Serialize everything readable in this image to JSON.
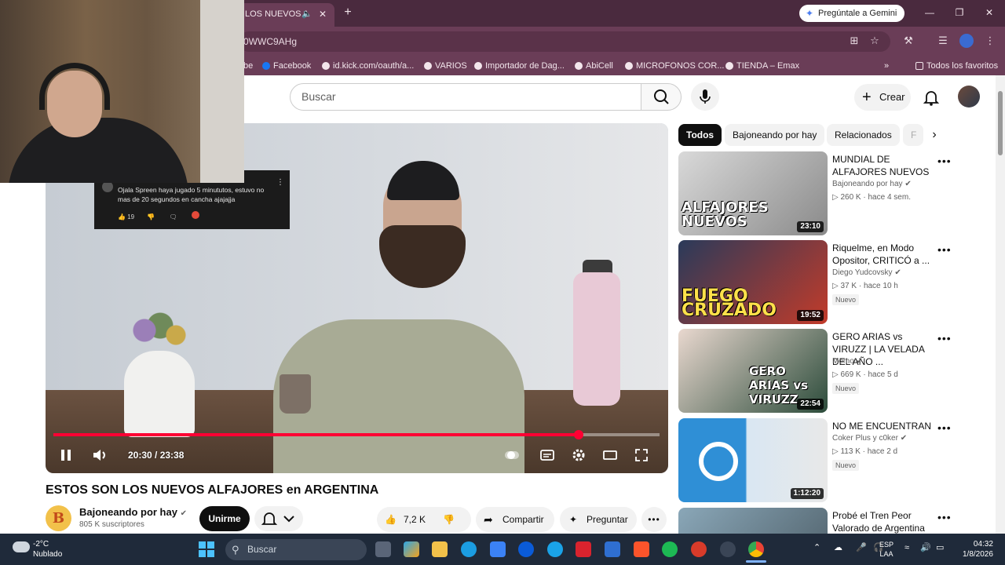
{
  "browser": {
    "tab_title": "LOS NUEVOS A",
    "tab_audio_icon": "speaker-icon",
    "new_tab": "+",
    "gemini_button": "Pregúntale a Gemini",
    "url": "0WWC9AHg",
    "bookmarks": [
      "be",
      "Facebook",
      "id.kick.com/oauth/a...",
      "VARIOS",
      "Importador de Dag...",
      "AbiCell",
      "MICROFONOS COR...",
      "TIENDA – Emax"
    ],
    "bookmarks_more": "»",
    "all_bookmarks": "Todos los favoritos"
  },
  "youtube": {
    "search_placeholder": "Buscar",
    "create_label": "Crear",
    "chips": [
      "Todos",
      "Bajoneando por hay",
      "Relacionados",
      "F"
    ],
    "player": {
      "time": "20:30 / 23:38",
      "progress": 0.867,
      "comment_text": "Ojala Spreen haya jugado 5 minututos, estuvo no mas de 20 segundos en cancha ajajajja",
      "comment_likes": "19"
    },
    "video": {
      "title": "ESTOS SON LOS NUEVOS ALFAJORES en ARGENTINA",
      "channel": "Bajoneando por hay",
      "subscribers": "805 K suscriptores",
      "channel_initial": "B",
      "join_label": "Unirme",
      "likes": "7,2 K",
      "share_label": "Compartir",
      "ask_label": "Preguntar"
    },
    "recommendations": [
      {
        "title": "MUNDIAL DE ALFAJORES NUEVOS",
        "channel": "Bajoneando por hay",
        "views": "260 K",
        "age": "hace 4 sem.",
        "duration": "23:10",
        "badge": "",
        "thumb_text": "ALFAJORES NUEVOS"
      },
      {
        "title": "Riquelme, en Modo Opositor, CRITICÓ a ...",
        "channel": "Diego Yudcovsky",
        "views": "37 K",
        "age": "hace 10 h",
        "duration": "19:52",
        "badge": "Nuevo",
        "thumb_text": "FUEGO CRUZADO"
      },
      {
        "title": "GERO ARIAS vs VIRUZZ | LA VELADA DEL AÑO ...",
        "channel": "Momo",
        "views": "669 K",
        "age": "hace 5 d",
        "duration": "22:54",
        "badge": "Nuevo",
        "thumb_text": "GERO ARIAS vs VIRUZZ"
      },
      {
        "title": "NO ME ENCUENTRAN",
        "channel": "Coker Plus y c0ker",
        "views": "113 K",
        "age": "hace 2 d",
        "duration": "1:12:20",
        "badge": "Nuevo",
        "thumb_text": ""
      },
      {
        "title": "Probé el Tren Peor Valorado de Argentina",
        "channel": "",
        "views": "",
        "age": "",
        "duration": "",
        "badge": "",
        "thumb_text": ""
      }
    ]
  },
  "taskbar": {
    "temperature": "-2°C",
    "weather": "Nublado",
    "search_placeholder": "Buscar",
    "language": "ESP",
    "layout": "LAA",
    "time": "04:32",
    "date": "1/8/2026"
  }
}
